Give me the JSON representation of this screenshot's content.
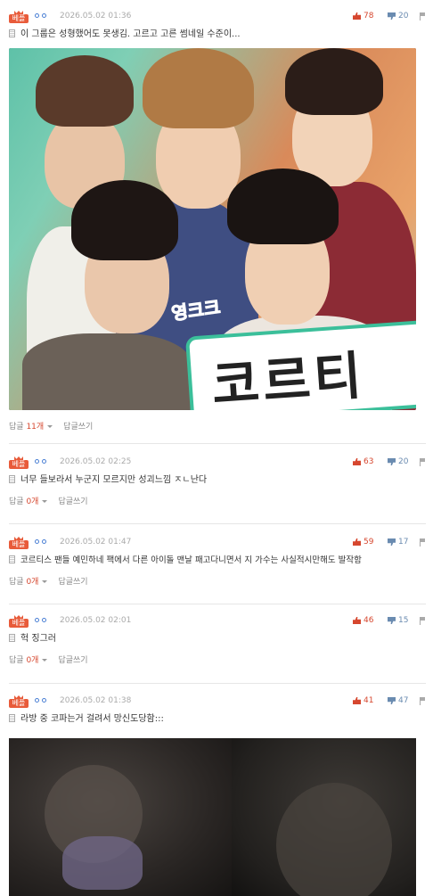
{
  "badge_label": "베플",
  "comments": [
    {
      "date": "2026.05.02 01:36",
      "up": "78",
      "down": "20",
      "text": "이 그룹은 성형했어도 못생김. 고르고 고른 썸네일 수준이...",
      "reply_label": "답글",
      "reply_count": "11개",
      "write_label": "답글쓰기"
    },
    {
      "date": "2026.05.02 02:25",
      "up": "63",
      "down": "20",
      "text": "너무 들보라서 누군지 모르지만 성괴느낌 ㅈㄴ난다",
      "reply_label": "답글",
      "reply_count": "0개",
      "write_label": "답글쓰기"
    },
    {
      "date": "2026.05.02 01:47",
      "up": "59",
      "down": "17",
      "text": "코르티스 팬들 예민하네 팩에서 다른 아이돌 맨날 패고다니면서 지 가수는 사실적시만해도 발작함",
      "reply_label": "답글",
      "reply_count": "0개",
      "write_label": "답글쓰기"
    },
    {
      "date": "2026.05.02 02:01",
      "up": "46",
      "down": "15",
      "text": "헉 징그러",
      "reply_label": "답글",
      "reply_count": "0개",
      "write_label": "답글쓰기"
    },
    {
      "date": "2026.05.02 01:38",
      "up": "41",
      "down": "47",
      "text": "라방 중 코파는거 걸려서 망신도당함:::"
    }
  ],
  "photo1": {
    "caption_small": "영크크",
    "caption_big": "코르티"
  },
  "colors": {
    "accent": "#e85b3a",
    "up": "#d6472f",
    "down": "#6a8bb0",
    "dots": "#4a7fd4"
  }
}
